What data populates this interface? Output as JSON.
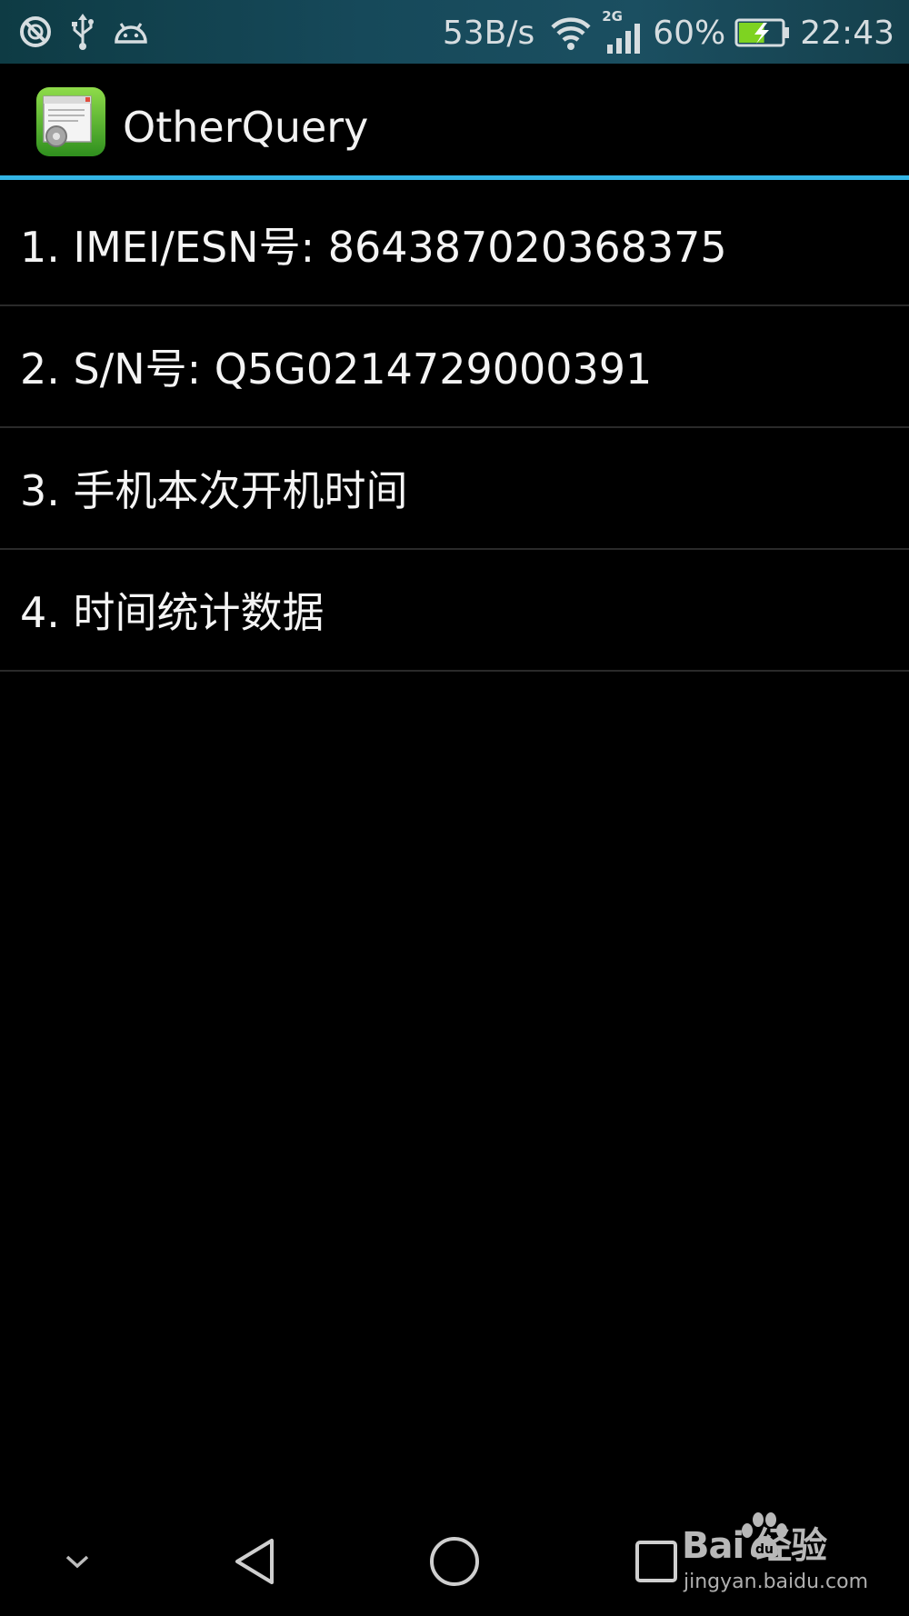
{
  "status_bar": {
    "left_icons": [
      "notification-icon",
      "usb-icon",
      "android-debug-icon"
    ],
    "net_speed": "53B/s",
    "wifi_icon": "wifi-icon",
    "network_type": "2G",
    "signal_icon": "signal-icon",
    "battery_percent": "60%",
    "battery_level": 0.6,
    "battery_charging": true,
    "time": "22:43",
    "colors": {
      "battery_fill": "#7ed321",
      "text": "#d6dde0"
    }
  },
  "action_bar": {
    "icon": "app-icon",
    "title": "OtherQuery",
    "accent_color": "#33b5e5"
  },
  "list": {
    "items": [
      {
        "label": "1. IMEI/ESN号: 864387020368375"
      },
      {
        "label": "2. S/N号: Q5G0214729000391"
      },
      {
        "label": "3. 手机本次开机时间"
      },
      {
        "label": "4. 时间统计数据"
      }
    ]
  },
  "nav_bar": {
    "buttons": [
      "hide-nav-icon",
      "back-icon",
      "home-icon",
      "recents-icon"
    ]
  },
  "watermark": {
    "logo_text": "Bai  经验",
    "url": "jingyan.baidu.com"
  }
}
